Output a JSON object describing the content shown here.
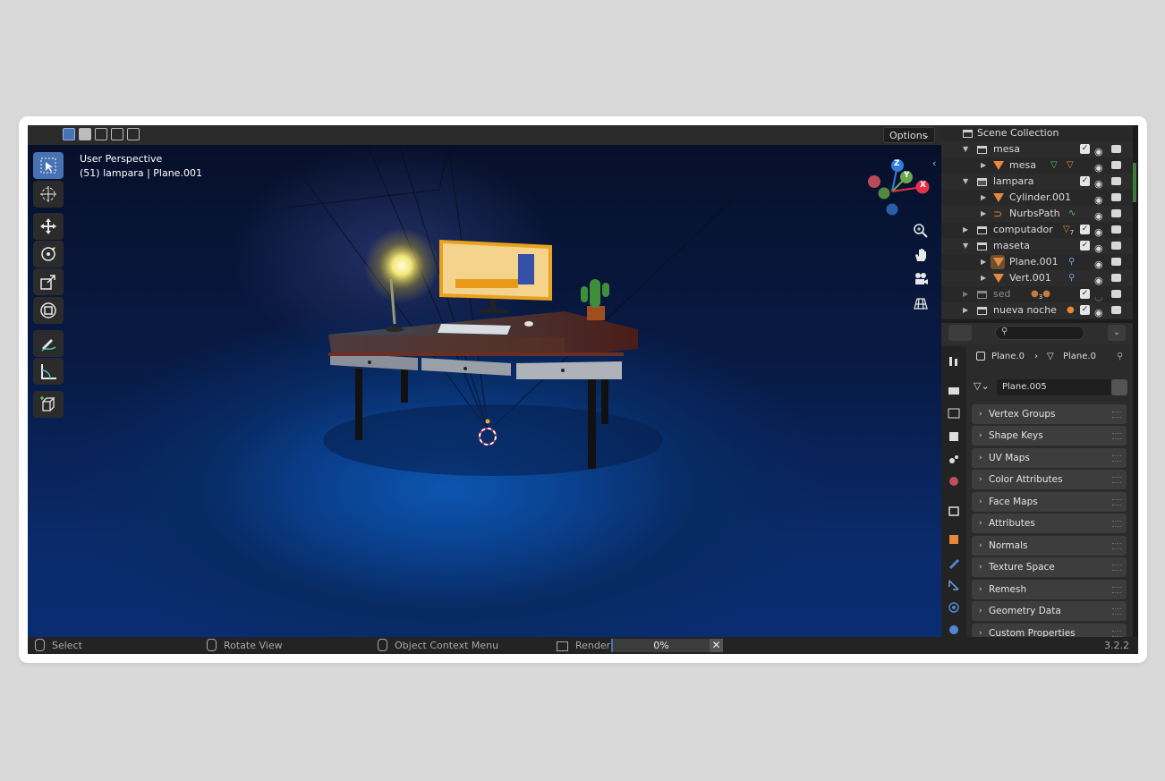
{
  "viewport": {
    "options_label": "Options",
    "view_name": "User Perspective",
    "object_info": "(51) lampara | Plane.001",
    "toolbar": [
      "select-box-tool",
      "cursor-tool",
      "move-tool",
      "rotate-tool",
      "scale-tool",
      "transform-tool",
      "annotate-tool",
      "measure-tool",
      "add-cube-tool"
    ],
    "gizmo_axes": [
      "Z",
      "Y",
      "X"
    ]
  },
  "outliner": {
    "rows": [
      {
        "label": "Scene Collection"
      },
      {
        "label": "mesa"
      },
      {
        "label": "mesa"
      },
      {
        "label": "lampara"
      },
      {
        "label": "Cylinder.001"
      },
      {
        "label": "NurbsPath"
      },
      {
        "label": "computador"
      },
      {
        "label": "maseta"
      },
      {
        "label": "Plane.001"
      },
      {
        "label": "Vert.001"
      },
      {
        "label": "sed"
      },
      {
        "label": "nueva noche"
      }
    ],
    "badges": {
      "computador": "7",
      "sed": "3"
    }
  },
  "properties": {
    "breadcrumb_object": "Plane.0",
    "breadcrumb_data": "Plane.0",
    "data_name": "Plane.005",
    "panels": [
      "Vertex Groups",
      "Shape Keys",
      "UV Maps",
      "Color Attributes",
      "Face Maps",
      "Attributes",
      "Normals",
      "Texture Space",
      "Remesh",
      "Geometry Data",
      "Custom Properties"
    ]
  },
  "statusbar": {
    "select": "Select",
    "rotate": "Rotate View",
    "context": "Object Context Menu",
    "render": "Render",
    "progress": "0%",
    "version": "3.2.2"
  },
  "colors": {
    "accent": "#4772b3",
    "x_axis": "#e3324a",
    "y_axis": "#6aa84f",
    "z_axis": "#2f7fd8",
    "object_orange": "#e9883a"
  }
}
